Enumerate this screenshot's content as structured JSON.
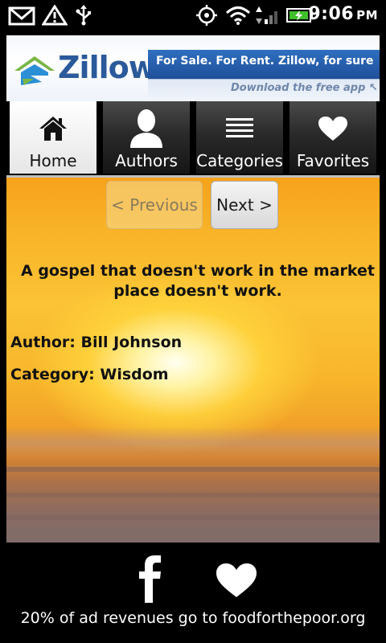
{
  "status_bar": {
    "time": "9:06",
    "ampm": "PM",
    "icons": [
      "gmail-icon",
      "warning-icon",
      "usb-icon",
      "gps-icon",
      "wifi-icon",
      "signal-icon",
      "battery-icon"
    ]
  },
  "ad": {
    "brand": "Zillow",
    "trademark": "®",
    "tagline": "For Sale. For Rent. Zillow, for sure",
    "subline": "Download the free app ↖"
  },
  "tabs": [
    {
      "label": "Home",
      "icon": "home-icon",
      "selected": true
    },
    {
      "label": "Authors",
      "icon": "person-icon",
      "selected": false
    },
    {
      "label": "Categories",
      "icon": "list-icon",
      "selected": false
    },
    {
      "label": "Favorites",
      "icon": "heart-icon",
      "selected": false
    }
  ],
  "nav": {
    "previous_label": "< Previous",
    "next_label": "Next >"
  },
  "quote": {
    "text": "A gospel that doesn't work in the market place doesn't work.",
    "author_line": "Author: Bill Johnson",
    "category_line": "Category: Wisdom"
  },
  "footer": {
    "text": "20% of ad revenues go to foodforthepoor.org"
  },
  "colors": {
    "zillow_blue": "#2b5a9b",
    "zillow_green": "#7ab648",
    "tab_selected_bg": "#ffffff",
    "tab_bg": "#2a2a2a"
  }
}
